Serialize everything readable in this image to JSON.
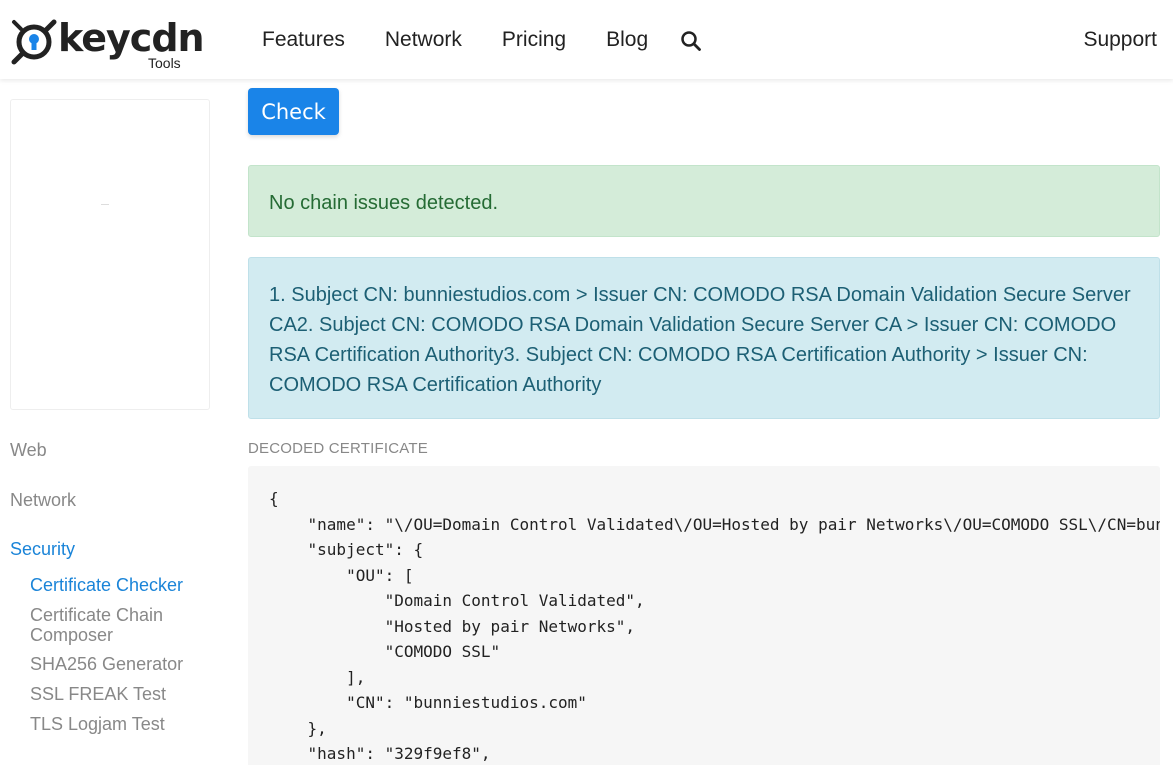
{
  "header": {
    "logo_text": "keycdn",
    "logo_sub": "Tools",
    "nav": [
      "Features",
      "Network",
      "Pricing",
      "Blog"
    ],
    "support": "Support"
  },
  "sidebar": {
    "categories": [
      {
        "label": "Web",
        "active": false
      },
      {
        "label": "Network",
        "active": false
      },
      {
        "label": "Security",
        "active": true
      }
    ],
    "security_items": [
      {
        "label": "Certificate Checker",
        "active": true
      },
      {
        "label": "Certificate Chain Composer",
        "active": false
      },
      {
        "label": "SHA256 Generator",
        "active": false
      },
      {
        "label": "SSL FREAK Test",
        "active": false
      },
      {
        "label": "TLS Logjam Test",
        "active": false
      }
    ]
  },
  "main": {
    "check_label": "Check",
    "success_message": "No chain issues detected.",
    "chain_info": "1. Subject CN: bunniestudios.com > Issuer CN: COMODO RSA Domain Validation Secure Server CA2. Subject CN: COMODO RSA Domain Validation Secure Server CA > Issuer CN: COMODO RSA Certification Authority3. Subject CN: COMODO RSA Certification Authority > Issuer CN: COMODO RSA Certification Authority",
    "decoded_label": "DECODED CERTIFICATE",
    "decoded_json": "{\n    \"name\": \"\\/OU=Domain Control Validated\\/OU=Hosted by pair Networks\\/OU=COMODO SSL\\/CN=bunniestudios.com\",\n    \"subject\": {\n        \"OU\": [\n            \"Domain Control Validated\",\n            \"Hosted by pair Networks\",\n            \"COMODO SSL\"\n        ],\n        \"CN\": \"bunniestudios.com\"\n    },\n    \"hash\": \"329f9ef8\","
  },
  "colors": {
    "accent": "#1a84e8",
    "success_bg": "#d4ecd9",
    "info_bg": "#d2ebf1"
  }
}
